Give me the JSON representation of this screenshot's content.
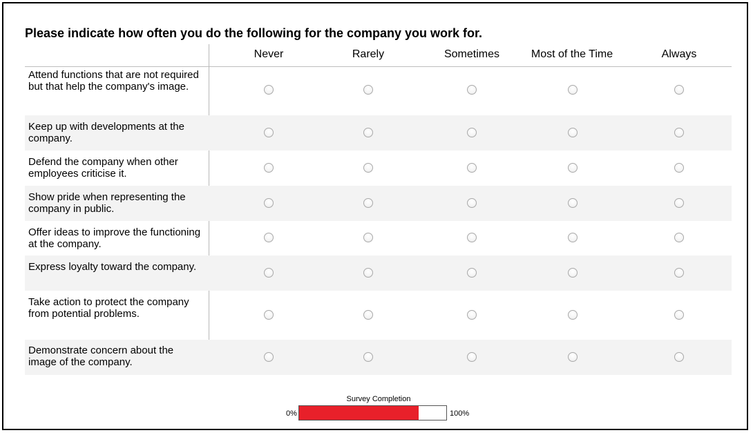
{
  "question": {
    "title": "Please indicate how often you do the following for the company you work for."
  },
  "scale": {
    "columns": [
      "Never",
      "Rarely",
      "Sometimes",
      "Most of the Time",
      "Always"
    ]
  },
  "statements": [
    "Attend functions that are not required but that help the company's image.",
    "Keep up with developments at the company.",
    "Defend the company when other employees criticise it.",
    "Show pride when representing the company in public.",
    "Offer ideas to improve the functioning at the company.",
    "Express loyalty toward the company.",
    "Take action to protect the company from potential problems.",
    "Demonstrate concern about the image of the company."
  ],
  "progress": {
    "label": "Survey Completion",
    "min_label": "0%",
    "max_label": "100%",
    "value": 0.81,
    "color": "#e8202a"
  }
}
